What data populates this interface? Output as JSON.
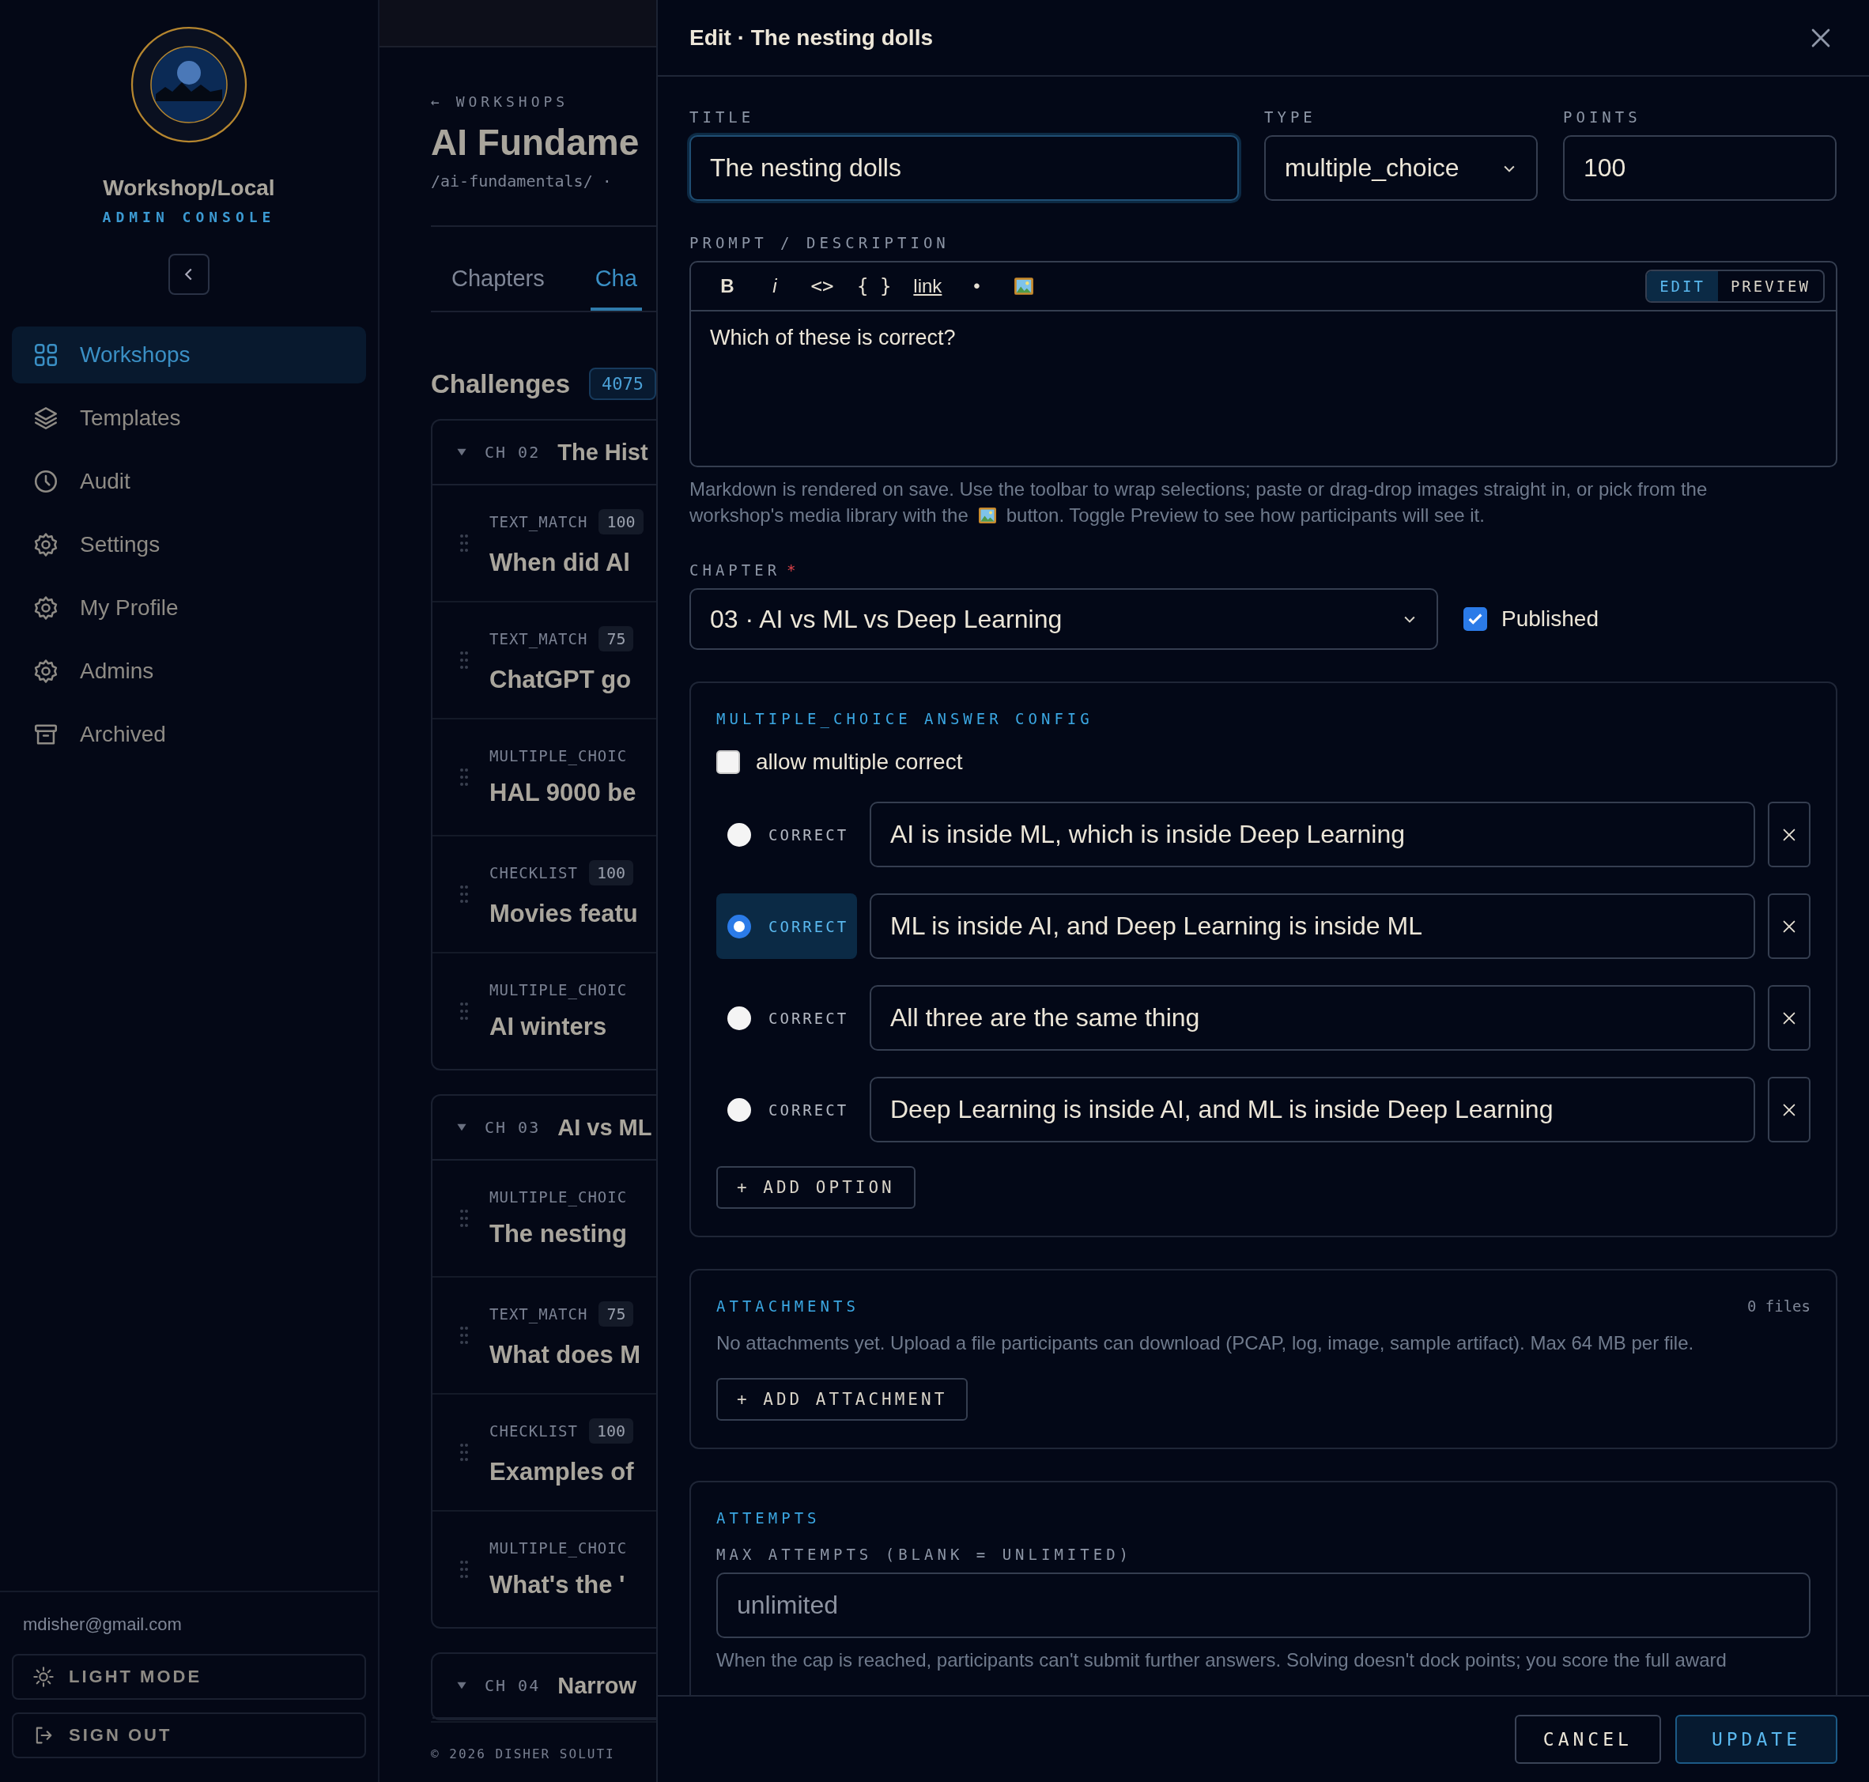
{
  "sidebar": {
    "brand": "Workshop/Local",
    "subtitle": "ADMIN CONSOLE",
    "nav": [
      {
        "label": "Workshops",
        "selected": true
      },
      {
        "label": "Templates",
        "selected": false
      },
      {
        "label": "Audit",
        "selected": false
      },
      {
        "label": "Settings",
        "selected": false
      },
      {
        "label": "My Profile",
        "selected": false
      },
      {
        "label": "Admins",
        "selected": false
      },
      {
        "label": "Archived",
        "selected": false
      }
    ],
    "email": "mdisher@gmail.com",
    "buttons": [
      {
        "label": "LIGHT MODE"
      },
      {
        "label": "SIGN OUT"
      }
    ]
  },
  "main": {
    "breadcrumb": "← WORKSHOPS",
    "title": "AI Fundame",
    "path": "/ai-fundamentals/ ·",
    "tabs": [
      {
        "label": "Chapters",
        "selected": false
      },
      {
        "label": "Cha",
        "selected": true
      }
    ],
    "section_title": "Challenges",
    "count": "4075",
    "chapters": [
      {
        "code": "CH 02",
        "title": "The Hist",
        "expanded": true,
        "items": [
          {
            "type": "TEXT_MATCH",
            "points": "100",
            "title": "When did Al"
          },
          {
            "type": "TEXT_MATCH",
            "points": "75",
            "title": "ChatGPT go"
          },
          {
            "type": "MULTIPLE_CHOIC",
            "title": "HAL 9000 be"
          },
          {
            "type": "CHECKLIST",
            "points": "100",
            "title": "Movies featu"
          },
          {
            "type": "MULTIPLE_CHOIC",
            "title": "AI winters"
          }
        ]
      },
      {
        "code": "CH 03",
        "title": "AI vs ML",
        "expanded": true,
        "items": [
          {
            "type": "MULTIPLE_CHOIC",
            "title": "The nesting"
          },
          {
            "type": "TEXT_MATCH",
            "points": "75",
            "title": "What does M"
          },
          {
            "type": "CHECKLIST",
            "points": "100",
            "title": "Examples of"
          },
          {
            "type": "MULTIPLE_CHOIC",
            "title": "What's the '"
          }
        ]
      },
      {
        "code": "CH 04",
        "title": "Narrow",
        "expanded": true
      }
    ],
    "footer": "© 2026 DISHER SOLUTI"
  },
  "drawer": {
    "title": "Edit · The nesting dolls",
    "fields": [
      {
        "kind": "text",
        "label": "TITLE",
        "value": "The nesting dolls",
        "focused": true
      },
      {
        "kind": "select",
        "label": "TYPE",
        "value": "multiple_choice",
        "focused": false
      },
      {
        "kind": "text",
        "label": "POINTS",
        "value": "100",
        "focused": false
      }
    ],
    "prompt": {
      "label": "PROMPT / DESCRIPTION",
      "toolbar": [
        {
          "kind": "bold",
          "label": "B"
        },
        {
          "kind": "italic",
          "label": "i"
        },
        {
          "kind": "code",
          "label": "<>"
        },
        {
          "kind": "block",
          "label": "{ }"
        },
        {
          "kind": "link",
          "label": "link"
        },
        {
          "kind": "list",
          "label": "•"
        },
        {
          "kind": "image"
        }
      ],
      "modes": [
        {
          "label": "EDIT",
          "selected": true
        },
        {
          "label": "PREVIEW",
          "selected": false
        }
      ],
      "value": "Which of these is correct?",
      "help_line": "Markdown is rendered on save. Use the toolbar to wrap selections; paste or drag-drop images straight in, or pick from the",
      "help_before": "workshop's media library with the",
      "help_after": "button. Toggle Preview to see how participants will see it."
    },
    "chapter": {
      "label": "CHAPTER",
      "required": "*",
      "value": "03 · AI vs ML vs Deep Learning"
    },
    "published": {
      "label": "Published",
      "checked": true
    },
    "config": {
      "heading": "MULTIPLE_CHOICE ANSWER CONFIG",
      "allow_multiple": {
        "label": "allow multiple correct",
        "checked": false
      },
      "options": [
        {
          "tag": "CORRECT",
          "text": "AI is inside ML, which is inside Deep Learning",
          "selected": false
        },
        {
          "tag": "CORRECT",
          "text": "ML is inside AI, and Deep Learning is inside ML",
          "selected": true
        },
        {
          "tag": "CORRECT",
          "text": "All three are the same thing",
          "selected": false
        },
        {
          "tag": "CORRECT",
          "text": "Deep Learning is inside AI, and ML is inside Deep Learning",
          "selected": false
        }
      ],
      "add_option": "+ ADD OPTION"
    },
    "attachments": {
      "heading": "ATTACHMENTS",
      "count": "0 files",
      "note": "No attachments yet. Upload a file participants can download (PCAP, log, image, sample artifact). Max 64 MB per file.",
      "button": "+ ADD ATTACHMENT"
    },
    "attempts": {
      "heading": "ATTEMPTS",
      "label": "MAX ATTEMPTS (BLANK = UNLIMITED)",
      "placeholder": "unlimited",
      "help": "When the cap is reached, participants can't submit further answers. Solving doesn't dock points; you score the full award"
    },
    "buttons": [
      {
        "label": "CANCEL",
        "kind": "secondary"
      },
      {
        "label": "UPDATE",
        "kind": "primary"
      }
    ]
  }
}
